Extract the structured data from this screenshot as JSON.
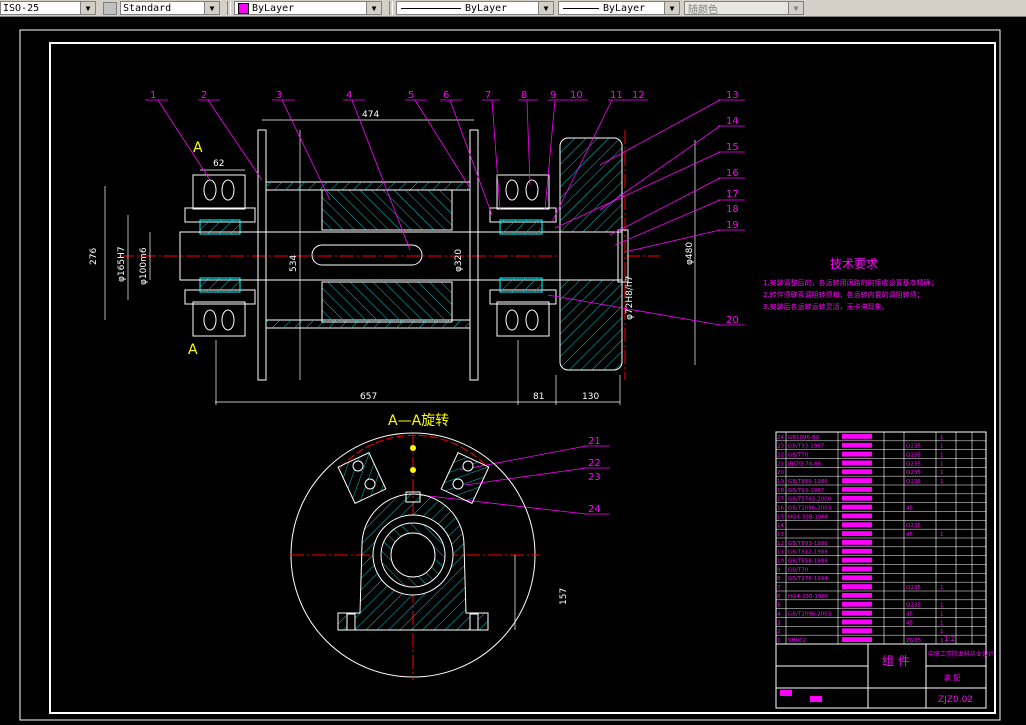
{
  "toolbar": {
    "dimstyle": "ISO-25",
    "textstyle": "Standard",
    "layer": "ByLayer",
    "linetype": "ByLayer",
    "lineweight": "ByLayer",
    "plotstyle": "随颜色"
  },
  "drawing": {
    "section_title": "A—A旋转",
    "tech_title": "技术要求",
    "tech_notes": [
      "1.安装调整后的，各运转用闭路的的接收设置基本精确；",
      "2.转件须联系调阻转须和，各运转内置的调阻转须；",
      "3.安装后各运转运转灵活，无卡滞现象。"
    ],
    "section_marks": [
      "A",
      "A"
    ],
    "balloons": [
      "1",
      "2",
      "3",
      "4",
      "5",
      "6",
      "7",
      "8",
      "9",
      "10",
      "11",
      "12",
      "13",
      "14",
      "15",
      "16",
      "17",
      "18",
      "19",
      "20",
      "21",
      "22",
      "23",
      "24"
    ],
    "dims": {
      "d474": "474",
      "d62": "62",
      "d276": "276",
      "d165": "φ165H7",
      "d100": "φ100m6",
      "d534": "534",
      "d320": "φ320",
      "d72": "φ72H8/h7",
      "d480": "φ480",
      "d657": "657",
      "d81": "81",
      "d130": "130",
      "d157": "157"
    }
  },
  "title_block": {
    "name": "组 件",
    "drawing_no": "ZJZ0.02",
    "school": "中原工学院本科毕业设计",
    "sheet": "装 配",
    "scale": "1:2"
  },
  "bom_rows": [
    {
      "no": "24",
      "code": "GB1096-89",
      "mat": "",
      "qty": "1"
    },
    {
      "no": "23",
      "code": "GB/T93-1987",
      "mat": "Q235",
      "qty": "1"
    },
    {
      "no": "22",
      "code": "GB/T70",
      "mat": "Q235",
      "qty": "1"
    },
    {
      "no": "21",
      "code": "JB/ZQ 78-86",
      "mat": "Q235",
      "qty": "1"
    },
    {
      "no": "20",
      "code": "",
      "mat": "Q235",
      "qty": "1"
    },
    {
      "no": "19",
      "code": "GB/T889-1986",
      "mat": "Q235",
      "qty": "1"
    },
    {
      "no": "18",
      "code": "GB/T93-1987",
      "mat": "",
      "qty": ""
    },
    {
      "no": "17",
      "code": "GB/T5783-2000",
      "mat": "",
      "qty": ""
    },
    {
      "no": "16",
      "code": "GB/T1096-2003",
      "mat": "45",
      "qty": ""
    },
    {
      "no": "15",
      "code": "HG4-338-1966",
      "mat": "",
      "qty": ""
    },
    {
      "no": "14",
      "code": "",
      "mat": "Q235",
      "qty": ""
    },
    {
      "no": "13",
      "code": "",
      "mat": "45",
      "qty": "1"
    },
    {
      "no": "12",
      "code": "GB/T893-1986",
      "mat": "",
      "qty": ""
    },
    {
      "no": "11",
      "code": "GB/T812-1988",
      "mat": "",
      "qty": ""
    },
    {
      "no": "10",
      "code": "GB/T858-1988",
      "mat": "",
      "qty": ""
    },
    {
      "no": "9",
      "code": "GB/T70",
      "mat": "",
      "qty": ""
    },
    {
      "no": "8",
      "code": "GB/T276-1994",
      "mat": "",
      "qty": ""
    },
    {
      "no": "7",
      "code": "",
      "mat": "Q235",
      "qty": "1"
    },
    {
      "no": "6",
      "code": "HG4-338-1966",
      "mat": "",
      "qty": ""
    },
    {
      "no": "5",
      "code": "",
      "mat": "Q235",
      "qty": "1"
    },
    {
      "no": "4",
      "code": "GB/T1096-2003",
      "mat": "45",
      "qty": "1"
    },
    {
      "no": "3",
      "code": "",
      "mat": "45",
      "qty": "1"
    },
    {
      "no": "2",
      "code": "",
      "mat": "",
      "qty": "1"
    },
    {
      "no": "1",
      "code": "SH002",
      "mat": "ZG35",
      "qty": "1"
    }
  ]
}
